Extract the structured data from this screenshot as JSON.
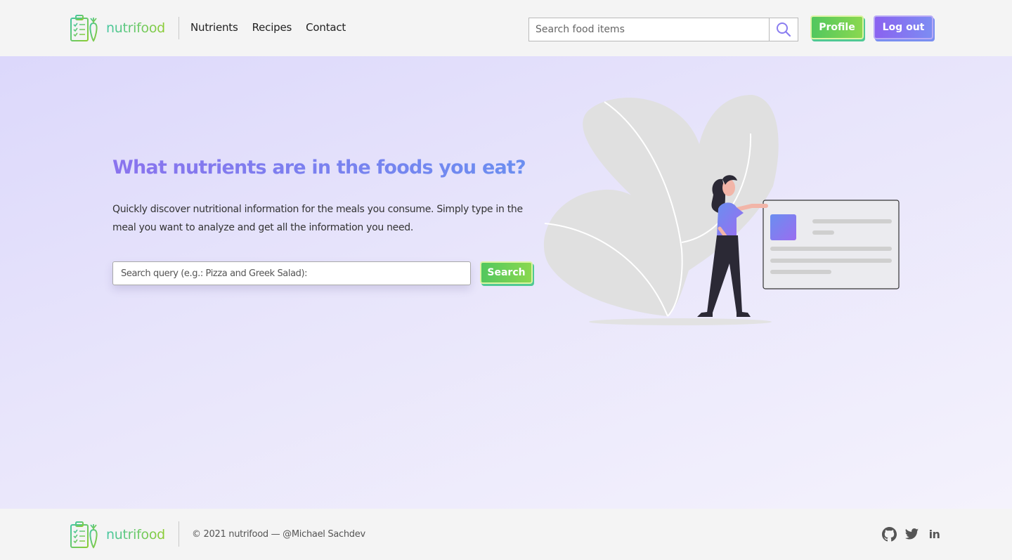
{
  "header": {
    "brand": "nutrifood",
    "nav": [
      "Nutrients",
      "Recipes",
      "Contact"
    ],
    "search_placeholder": "Search food items",
    "profile_label": "Profile",
    "logout_label": "Log out"
  },
  "hero": {
    "title": "What nutrients are in the foods you eat?",
    "description": "Quickly discover nutritional information for the meals you consume. Simply type in the meal you want to analyze and get all the information you need.",
    "search_placeholder": "Search query (e.g.: Pizza and Greek Salad):",
    "search_label": "Search"
  },
  "footer": {
    "brand": "nutrifood",
    "copyright": "© 2021 nutrifood — @Michael Sachdev",
    "social": [
      "github-icon",
      "twitter-icon",
      "linkedin-icon"
    ]
  },
  "colors": {
    "brand_green": "#8ccc33",
    "brand_teal": "#45c6a1",
    "accent_purple": "#8a62f0",
    "button_green": "#52c75e",
    "hero_bg": "#e5e1fb"
  }
}
